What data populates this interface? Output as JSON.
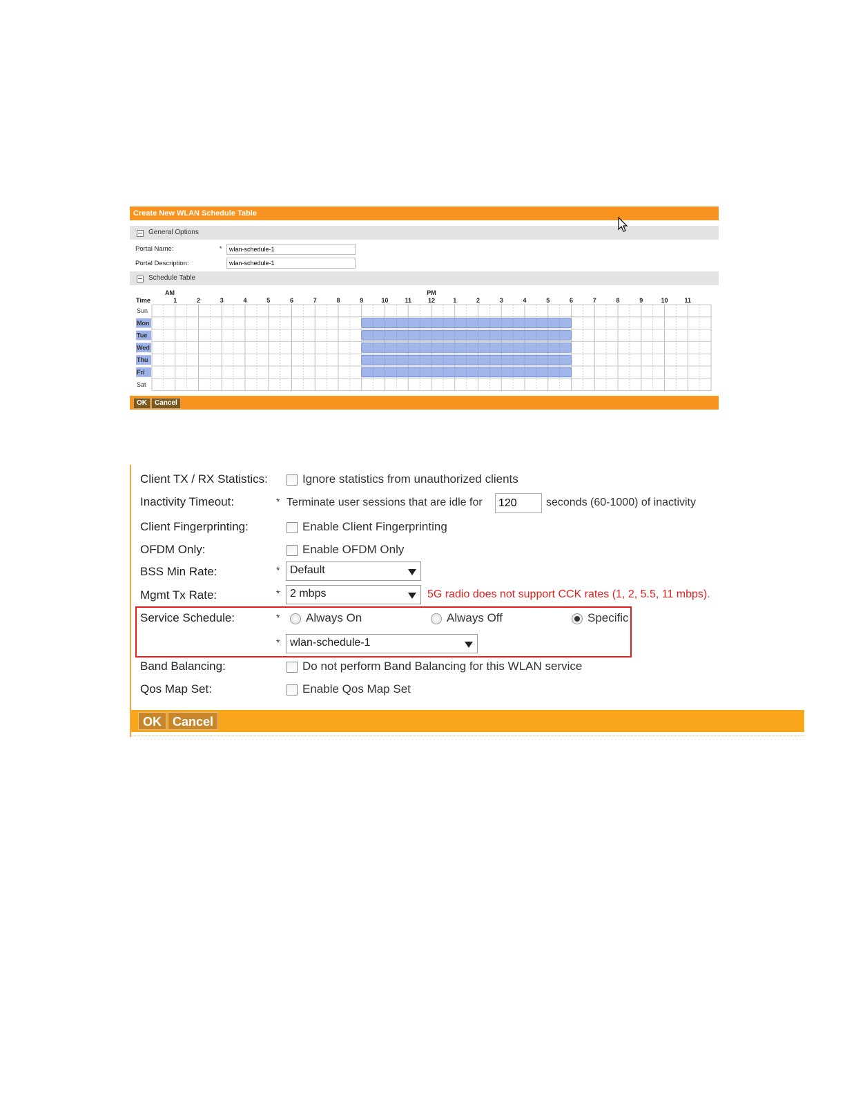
{
  "schedule_dialog": {
    "title": "Create New WLAN Schedule Table",
    "general_options": "General Options",
    "portal_name_label": "Portal Name:",
    "portal_name_value": "wlan-schedule-1",
    "portal_description_label": "Portal Description:",
    "portal_description_value": "wlan-schedule-1",
    "required_marker": "*",
    "schedule_table": "Schedule Table",
    "time_label": "Time",
    "am_label": "AM",
    "pm_label": "PM",
    "hour_labels": [
      "1",
      "2",
      "3",
      "4",
      "5",
      "6",
      "7",
      "8",
      "9",
      "10",
      "11",
      "12",
      "1",
      "2",
      "3",
      "4",
      "5",
      "6",
      "7",
      "8",
      "9",
      "10",
      "11"
    ],
    "days": [
      {
        "label": "Sun",
        "selected": false
      },
      {
        "label": "Mon",
        "selected": true
      },
      {
        "label": "Tue",
        "selected": true
      },
      {
        "label": "Wed",
        "selected": true
      },
      {
        "label": "Thu",
        "selected": true
      },
      {
        "label": "Fri",
        "selected": true
      },
      {
        "label": "Sat",
        "selected": false
      }
    ],
    "selected_hours": {
      "start": 9,
      "end": 18
    },
    "highlight_color": "#9db3e8",
    "ok_label": "OK",
    "cancel_label": "Cancel"
  },
  "wlan_form": {
    "client_stats": {
      "label": "Client TX / RX Statistics:",
      "option": "Ignore statistics from unauthorized clients"
    },
    "inactivity": {
      "label": "Inactivity Timeout:",
      "text_before": "Terminate user sessions that are idle for",
      "value": "120",
      "text_after": "seconds (60-1000) of inactivity"
    },
    "fingerprinting": {
      "label": "Client Fingerprinting:",
      "option": "Enable Client Fingerprinting"
    },
    "ofdm": {
      "label": "OFDM Only:",
      "option": "Enable OFDM Only"
    },
    "bss_min_rate": {
      "label": "BSS Min Rate:",
      "value": "Default"
    },
    "mgmt_tx_rate": {
      "label": "Mgmt Tx Rate:",
      "value": "2 mbps",
      "warning": "5G radio does not support CCK rates (1, 2, 5.5, 11 mbps)."
    },
    "service_schedule": {
      "label": "Service Schedule:",
      "always_on": "Always On",
      "always_off": "Always Off",
      "specific": "Specific",
      "schedule_value": "wlan-schedule-1"
    },
    "band_balancing": {
      "label": "Band Balancing:",
      "option": "Do not perform Band Balancing for this WLAN service"
    },
    "qos_map": {
      "label": "Qos Map Set:",
      "option": "Enable Qos Map Set"
    },
    "required_marker": "*",
    "ok_label": "OK",
    "cancel_label": "Cancel",
    "warning_color": "#e0201c",
    "accent_color": "#faa61a"
  }
}
